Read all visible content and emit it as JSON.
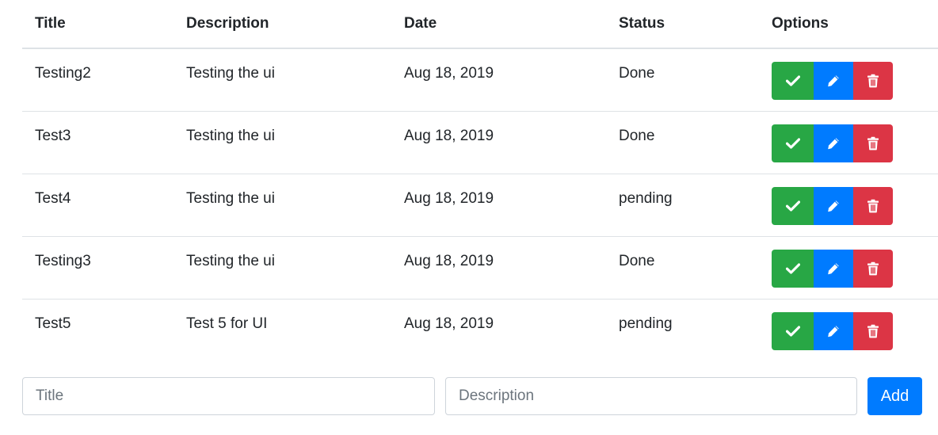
{
  "table": {
    "headers": [
      "Title",
      "Description",
      "Date",
      "Status",
      "Options"
    ],
    "rows": [
      {
        "title": "Testing2",
        "description": "Testing the ui",
        "date": "Aug 18, 2019",
        "status": "Done"
      },
      {
        "title": "Test3",
        "description": "Testing the ui",
        "date": "Aug 18, 2019",
        "status": "Done"
      },
      {
        "title": "Test4",
        "description": "Testing the ui",
        "date": "Aug 18, 2019",
        "status": "pending"
      },
      {
        "title": "Testing3",
        "description": "Testing the ui",
        "date": "Aug 18, 2019",
        "status": "Done"
      },
      {
        "title": "Test5",
        "description": "Test 5 for UI",
        "date": "Aug 18, 2019",
        "status": "pending"
      }
    ],
    "option_icons": [
      "check-icon",
      "pencil-icon",
      "trash-icon"
    ]
  },
  "form": {
    "title_value": "",
    "title_placeholder": "Title",
    "description_value": "",
    "description_placeholder": "Description",
    "add_label": "Add"
  },
  "colors": {
    "success": "#28a745",
    "primary": "#007bff",
    "danger": "#dc3545",
    "border": "#dee2e6"
  }
}
